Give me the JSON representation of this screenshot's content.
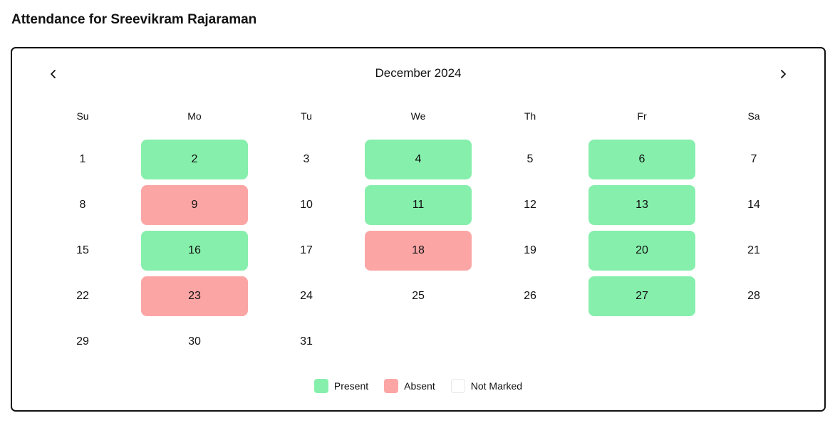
{
  "page": {
    "title": "Attendance for Sreevikram Rajaraman"
  },
  "calendar": {
    "month_label": "December 2024",
    "weekdays": [
      "Su",
      "Mo",
      "Tu",
      "We",
      "Th",
      "Fr",
      "Sa"
    ],
    "first_weekday_index": 0,
    "days": [
      {
        "day": "1",
        "status": "not_marked"
      },
      {
        "day": "2",
        "status": "present"
      },
      {
        "day": "3",
        "status": "not_marked"
      },
      {
        "day": "4",
        "status": "present"
      },
      {
        "day": "5",
        "status": "not_marked"
      },
      {
        "day": "6",
        "status": "present"
      },
      {
        "day": "7",
        "status": "not_marked"
      },
      {
        "day": "8",
        "status": "not_marked"
      },
      {
        "day": "9",
        "status": "absent"
      },
      {
        "day": "10",
        "status": "not_marked"
      },
      {
        "day": "11",
        "status": "present"
      },
      {
        "day": "12",
        "status": "not_marked"
      },
      {
        "day": "13",
        "status": "present"
      },
      {
        "day": "14",
        "status": "not_marked"
      },
      {
        "day": "15",
        "status": "not_marked"
      },
      {
        "day": "16",
        "status": "present"
      },
      {
        "day": "17",
        "status": "not_marked"
      },
      {
        "day": "18",
        "status": "absent"
      },
      {
        "day": "19",
        "status": "not_marked"
      },
      {
        "day": "20",
        "status": "present"
      },
      {
        "day": "21",
        "status": "not_marked"
      },
      {
        "day": "22",
        "status": "not_marked"
      },
      {
        "day": "23",
        "status": "absent"
      },
      {
        "day": "24",
        "status": "not_marked"
      },
      {
        "day": "25",
        "status": "not_marked"
      },
      {
        "day": "26",
        "status": "not_marked"
      },
      {
        "day": "27",
        "status": "present"
      },
      {
        "day": "28",
        "status": "not_marked"
      },
      {
        "day": "29",
        "status": "not_marked"
      },
      {
        "day": "30",
        "status": "not_marked"
      },
      {
        "day": "31",
        "status": "not_marked"
      }
    ],
    "nav": {
      "prev_icon": "chevron-left-icon",
      "next_icon": "chevron-right-icon"
    }
  },
  "legend": {
    "present": "Present",
    "absent": "Absent",
    "not_marked": "Not Marked"
  },
  "colors": {
    "present": "#86efac",
    "absent": "#fca5a5",
    "border": "#111111"
  }
}
